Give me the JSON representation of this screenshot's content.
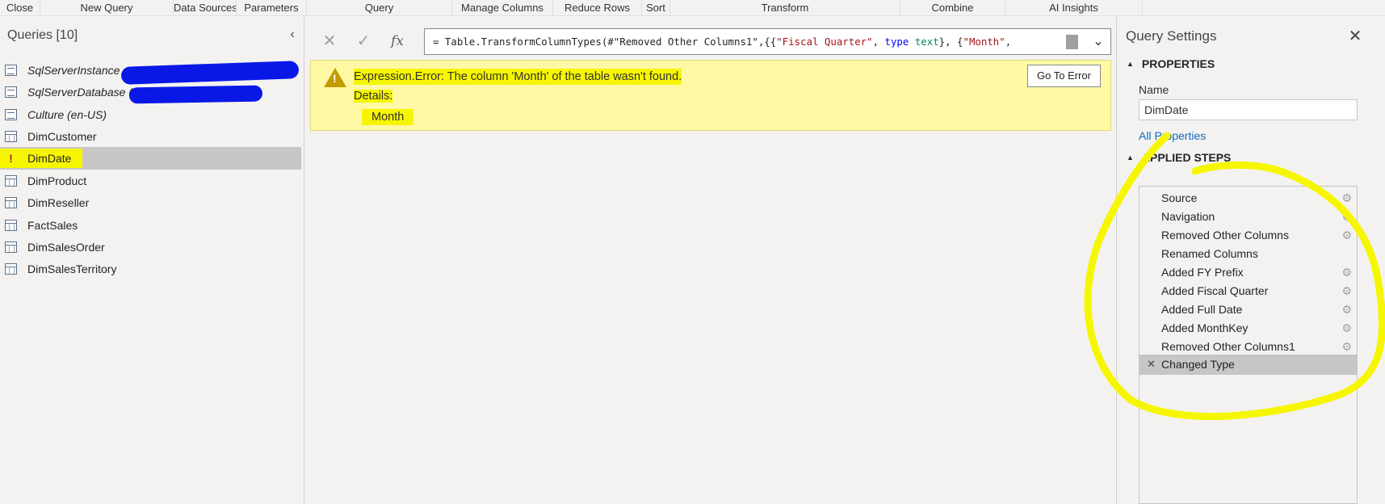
{
  "ribbon": {
    "groups": [
      "Close",
      "New Query",
      "Data Sources",
      "Parameters",
      "Query",
      "Manage Columns",
      "Reduce Rows",
      "Sort",
      "Transform",
      "Combine",
      "AI Insights"
    ]
  },
  "queries_pane": {
    "title": "Queries [10]",
    "items": [
      {
        "label": "SqlServerInstance",
        "kind": "parameter"
      },
      {
        "label": "SqlServerDatabase (",
        "kind": "parameter"
      },
      {
        "label": "Culture (en-US)",
        "kind": "parameter"
      },
      {
        "label": "DimCustomer",
        "kind": "table"
      },
      {
        "label": "DimDate",
        "kind": "table",
        "state": "error",
        "error_mark": "!"
      },
      {
        "label": "DimProduct",
        "kind": "table"
      },
      {
        "label": "DimReseller",
        "kind": "table"
      },
      {
        "label": "FactSales",
        "kind": "table"
      },
      {
        "label": "DimSalesOrder",
        "kind": "table"
      },
      {
        "label": "DimSalesTerritory",
        "kind": "table"
      }
    ],
    "selected": "DimDate"
  },
  "formula_bar": {
    "fx_label": "fx",
    "parts": {
      "p1": "= Table.TransformColumnTypes(#\"Removed Other Columns1\",{{",
      "s1": "\"Fiscal Quarter\"",
      "p2": ", ",
      "k1": "type",
      "sp": " ",
      "t1": "text",
      "p3": "}, {",
      "s2": "\"Month\"",
      "p4": ","
    }
  },
  "error": {
    "message": "Expression.Error: The column 'Month' of the table wasn't found.",
    "details_label": "Details:",
    "details_value": "Month",
    "button": "Go To Error"
  },
  "query_settings": {
    "title": "Query Settings",
    "properties_heading": "PROPERTIES",
    "name_label": "Name",
    "name_value": "DimDate",
    "all_properties_link": "All Properties",
    "applied_steps_heading": "APPLIED STEPS",
    "steps": [
      {
        "label": "Source",
        "gear": true
      },
      {
        "label": "Navigation",
        "gear": true
      },
      {
        "label": "Removed Other Columns",
        "gear": true
      },
      {
        "label": "Renamed Columns",
        "gear": false
      },
      {
        "label": "Added FY Prefix",
        "gear": true
      },
      {
        "label": "Added Fiscal Quarter",
        "gear": true
      },
      {
        "label": "Added Full Date",
        "gear": true
      },
      {
        "label": "Added MonthKey",
        "gear": true
      },
      {
        "label": "Removed Other Columns1",
        "gear": true
      },
      {
        "label": "Changed Type",
        "gear": false,
        "selected": true
      }
    ]
  },
  "colors": {
    "highlight": "#f6f600",
    "scribble": "#0a18e6",
    "link": "#106ebe",
    "error_banner": "#fff9a6"
  }
}
